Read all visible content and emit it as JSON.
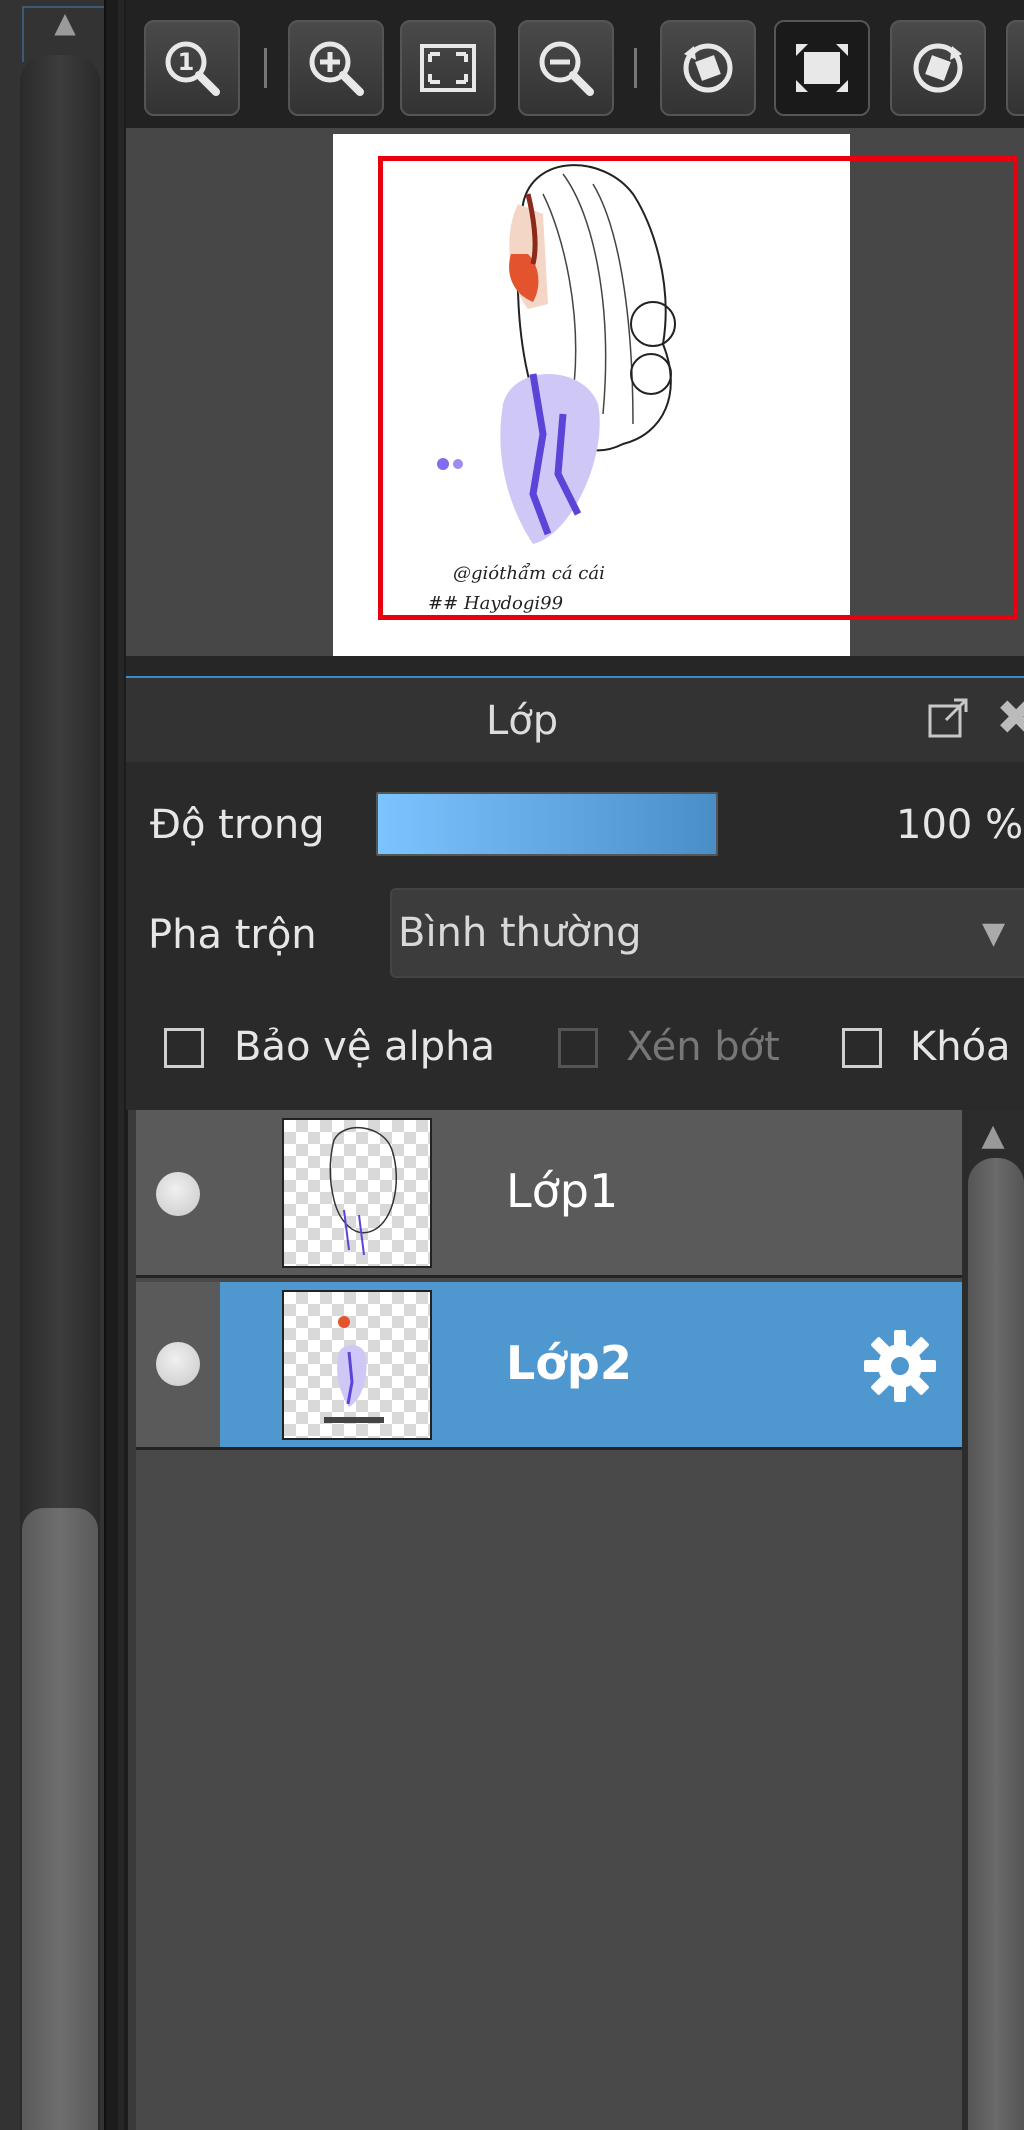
{
  "left_panel": {
    "scroll_up_icon": "triangle-up-icon"
  },
  "toolbar": {
    "buttons": [
      {
        "name": "zoom-actual-size-icon",
        "label": "1"
      },
      {
        "name": "zoom-in-icon"
      },
      {
        "name": "fit-to-window-icon"
      },
      {
        "name": "zoom-out-icon"
      },
      {
        "name": "rotate-left-icon"
      },
      {
        "name": "reset-rotation-icon"
      },
      {
        "name": "rotate-right-icon"
      }
    ]
  },
  "navigator": {
    "signature_line1": "@gióthẩm cá cái",
    "signature_line2": "## Haydogi99"
  },
  "layer_panel": {
    "title": "Lớp",
    "opacity_label": "Độ trong",
    "opacity_value": "100 %",
    "opacity_level": 1.0,
    "blend_label": "Pha trộn",
    "blend_value": "Bình thường",
    "protect_alpha_label": "Bảo vệ alpha",
    "clip_label": "Xén bớt",
    "lock_label": "Khóa",
    "layers": [
      {
        "name": "Lớp1",
        "selected": false,
        "visible": true
      },
      {
        "name": "Lớp2",
        "selected": true,
        "visible": true
      }
    ]
  },
  "colors": {
    "accent": "#4f97cf",
    "view_rect": "#e8000e",
    "opacity_gradient_start": "#7cc4ff",
    "opacity_gradient_end": "#4a8ec8"
  }
}
